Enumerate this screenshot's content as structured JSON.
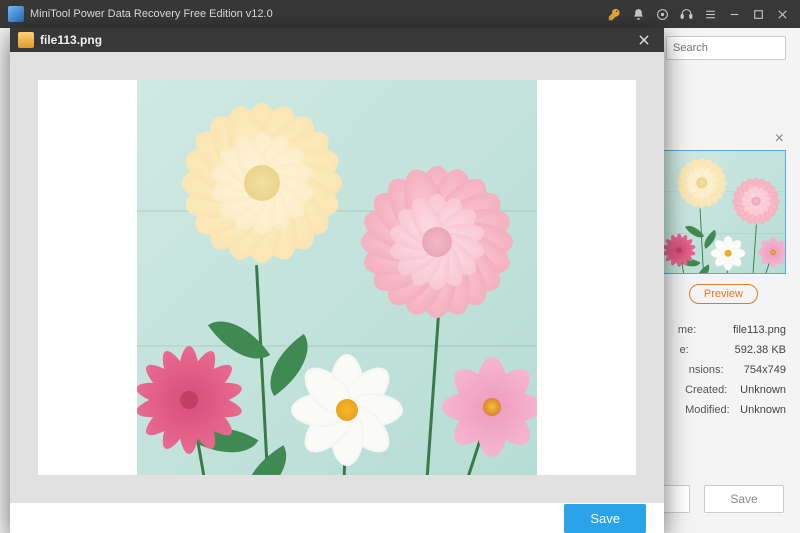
{
  "titlebar": {
    "app_title": "MiniTool Power Data Recovery Free Edition v12.0"
  },
  "background": {
    "search_placeholder": "Search",
    "preview_button": "Preview",
    "meta_labels": {
      "name": "me:",
      "size": "e:",
      "dimensions": "nsions:",
      "created": "Created:",
      "modified": "Modified:"
    },
    "meta_values": {
      "name": "file113.png",
      "size": "592.38 KB",
      "dimensions": "754x749",
      "created": "Unknown",
      "modified": "Unknown"
    },
    "save_button": "Save"
  },
  "modal": {
    "filename": "file113.png",
    "save_button": "Save"
  }
}
